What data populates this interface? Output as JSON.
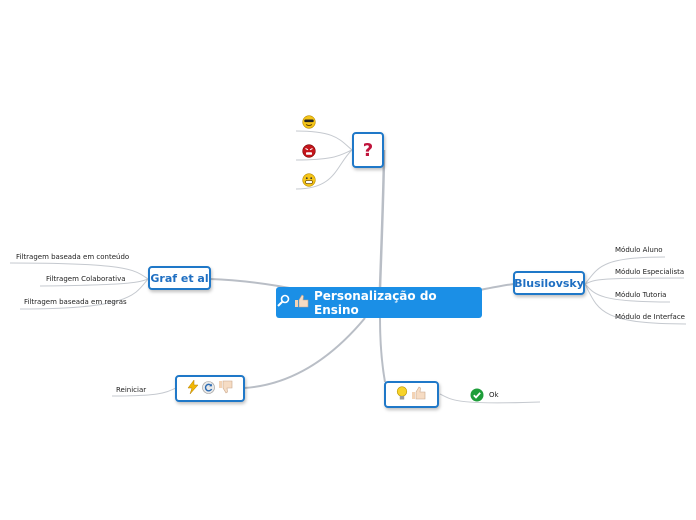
{
  "central": {
    "title": "Personalização do Ensino",
    "icons": [
      "magnifier-icon",
      "thumbs-up-icon"
    ]
  },
  "question_node": {
    "label": "?",
    "children": [
      "cool-face-icon",
      "angry-face-icon",
      "grin-face-icon"
    ]
  },
  "graf_node": {
    "label": "Graf et al",
    "children": [
      "Filtragem baseada em conteúdo",
      "Filtragem Colaborativa",
      "Filtragem baseada em regras"
    ]
  },
  "brusilovsky_node": {
    "label": "Blusilovsky",
    "children": [
      "Módulo Aluno",
      "Módulo Especialista",
      "Módulo Tutoria",
      "Módulo de Interface"
    ]
  },
  "restart_node": {
    "icons": [
      "lightning-icon",
      "refresh-icon",
      "thumbs-down-icon"
    ],
    "children": [
      "Reiniciar"
    ]
  },
  "idea_node": {
    "icons": [
      "lightbulb-icon",
      "thumbs-up-icon"
    ],
    "children": [
      {
        "icon": "check-icon",
        "label": "Ok"
      }
    ]
  },
  "colors": {
    "central": "#1b8fe6",
    "border": "#1f78c8",
    "text": "#1f6fc2",
    "connector": "#b9bec6",
    "question": "#c0143c",
    "check": "#1e9e3a"
  }
}
